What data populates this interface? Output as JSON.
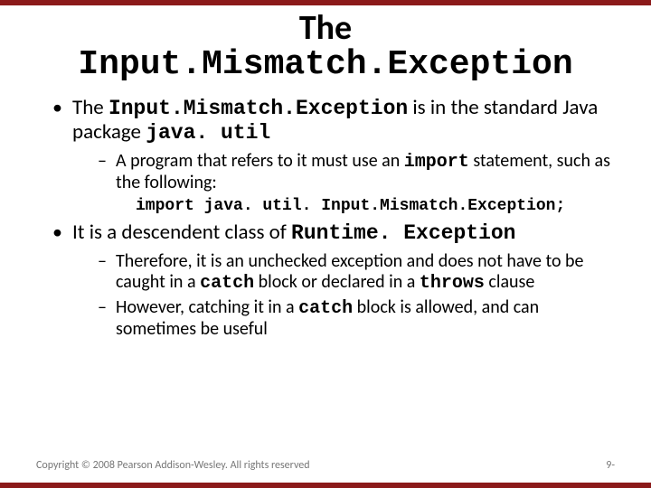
{
  "title": {
    "line1": "The",
    "line2": "Input.Mismatch.Exception"
  },
  "bullets": {
    "b1": {
      "pre": "The ",
      "code1": "Input.Mismatch.Exception",
      "mid": " is in the standard Java package ",
      "code2": "java. util"
    },
    "b1_sub1": {
      "pre": "A program that refers to it must use an ",
      "code1": "import",
      "post": " statement, such as the following:"
    },
    "code_line": "import java. util. Input.Mismatch.Exception;",
    "b2": {
      "pre": "It is a descendent class of ",
      "code1": "Runtime. Exception"
    },
    "b2_sub1": {
      "pre": "Therefore, it is an unchecked exception and does not have to be caught in a ",
      "code1": "catch",
      "mid": " block or declared in a ",
      "code2": "throws",
      "post": " clause"
    },
    "b2_sub2": {
      "pre": "However, catching it in a ",
      "code1": "catch",
      "post": " block is allowed, and can sometimes be useful"
    }
  },
  "footer": {
    "copyright": "Copyright © 2008 Pearson Addison-Wesley. All rights reserved",
    "page": "9-"
  }
}
